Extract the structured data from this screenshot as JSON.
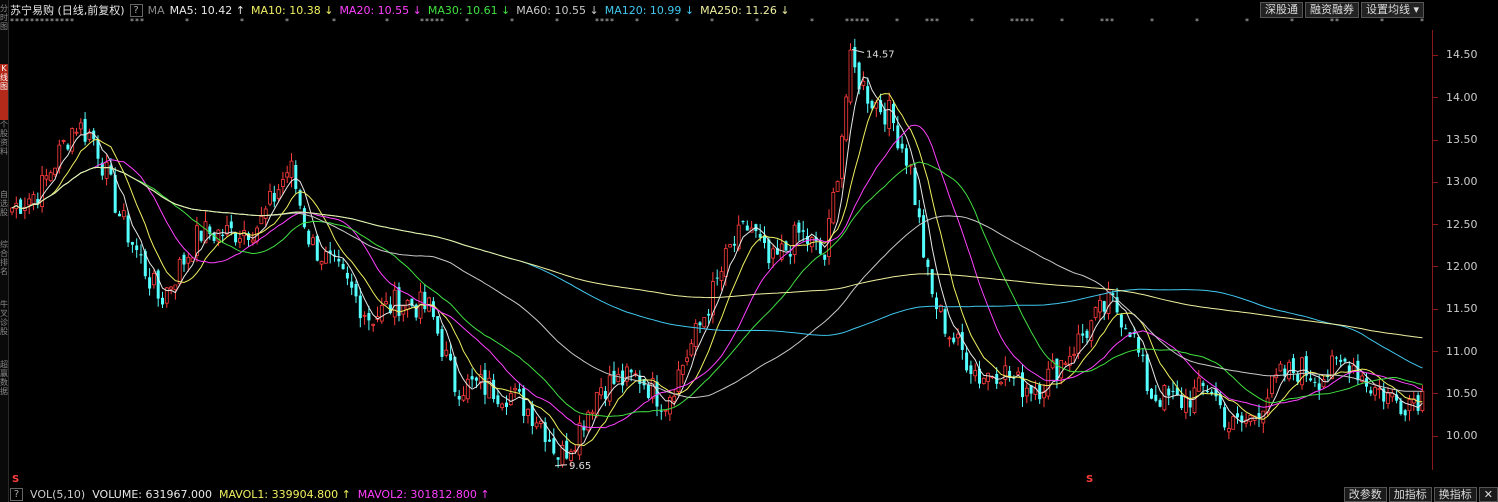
{
  "left_tabs": [
    "分时图",
    "K线图",
    "个股资料",
    "自选股",
    "综合排名",
    "牛叉诊股",
    "超赢数据"
  ],
  "header": {
    "title": "苏宁易购 (日线,前复权)",
    "help_label": "?",
    "ma_label": "MA",
    "indicators": [
      {
        "text": "MA5: 10.42 ↑",
        "color": "#e8e8e8"
      },
      {
        "text": "MA10: 10.38 ↓",
        "color": "#f0f060"
      },
      {
        "text": "MA20: 10.55 ↓",
        "color": "#ff40ff"
      },
      {
        "text": "MA30: 10.61 ↓",
        "color": "#40e040"
      },
      {
        "text": "MA60: 10.55 ↓",
        "color": "#c8c8c8"
      },
      {
        "text": "MA120: 10.99 ↓",
        "color": "#40c8f0"
      },
      {
        "text": "MA250: 11.26 ↓",
        "color": "#f0f0a0"
      }
    ]
  },
  "toolbar": {
    "shengutong": "深股通",
    "rongzi": "融资融券",
    "ma_settings": "设置均线 ▾"
  },
  "chart_data": {
    "type": "candlestick",
    "title": "苏宁易购 (日线,前复权)",
    "y_ticks": [
      "14.50",
      "14.00",
      "13.50",
      "13.00",
      "12.50",
      "12.00",
      "11.50",
      "11.00",
      "10.50",
      "10.00"
    ],
    "ylim": [
      9.6,
      14.8
    ],
    "annotations": [
      {
        "label": "14.57",
        "price": 14.57
      },
      {
        "label": "9.65",
        "price": 9.65
      }
    ],
    "grid": false,
    "colors": {
      "up": "#ff3c3c",
      "down": "#54ffff",
      "axis": "#8a1a1a"
    }
  },
  "volume_bar": {
    "help": "?",
    "vol": "VOL(5,10)",
    "volume": "VOLUME: 631967.000",
    "mavol1": "MAVOL1: 339904.800 ↑",
    "mavol2": "MAVOL2: 301812.800 ↑",
    "mavol1_color": "#f0f060",
    "mavol2_color": "#ff40ff"
  },
  "bottom_buttons": {
    "params": "改参数",
    "add": "加指标",
    "switch": "换指标",
    "close": "✕"
  },
  "markers": {
    "s1": "S",
    "s2": "S"
  }
}
